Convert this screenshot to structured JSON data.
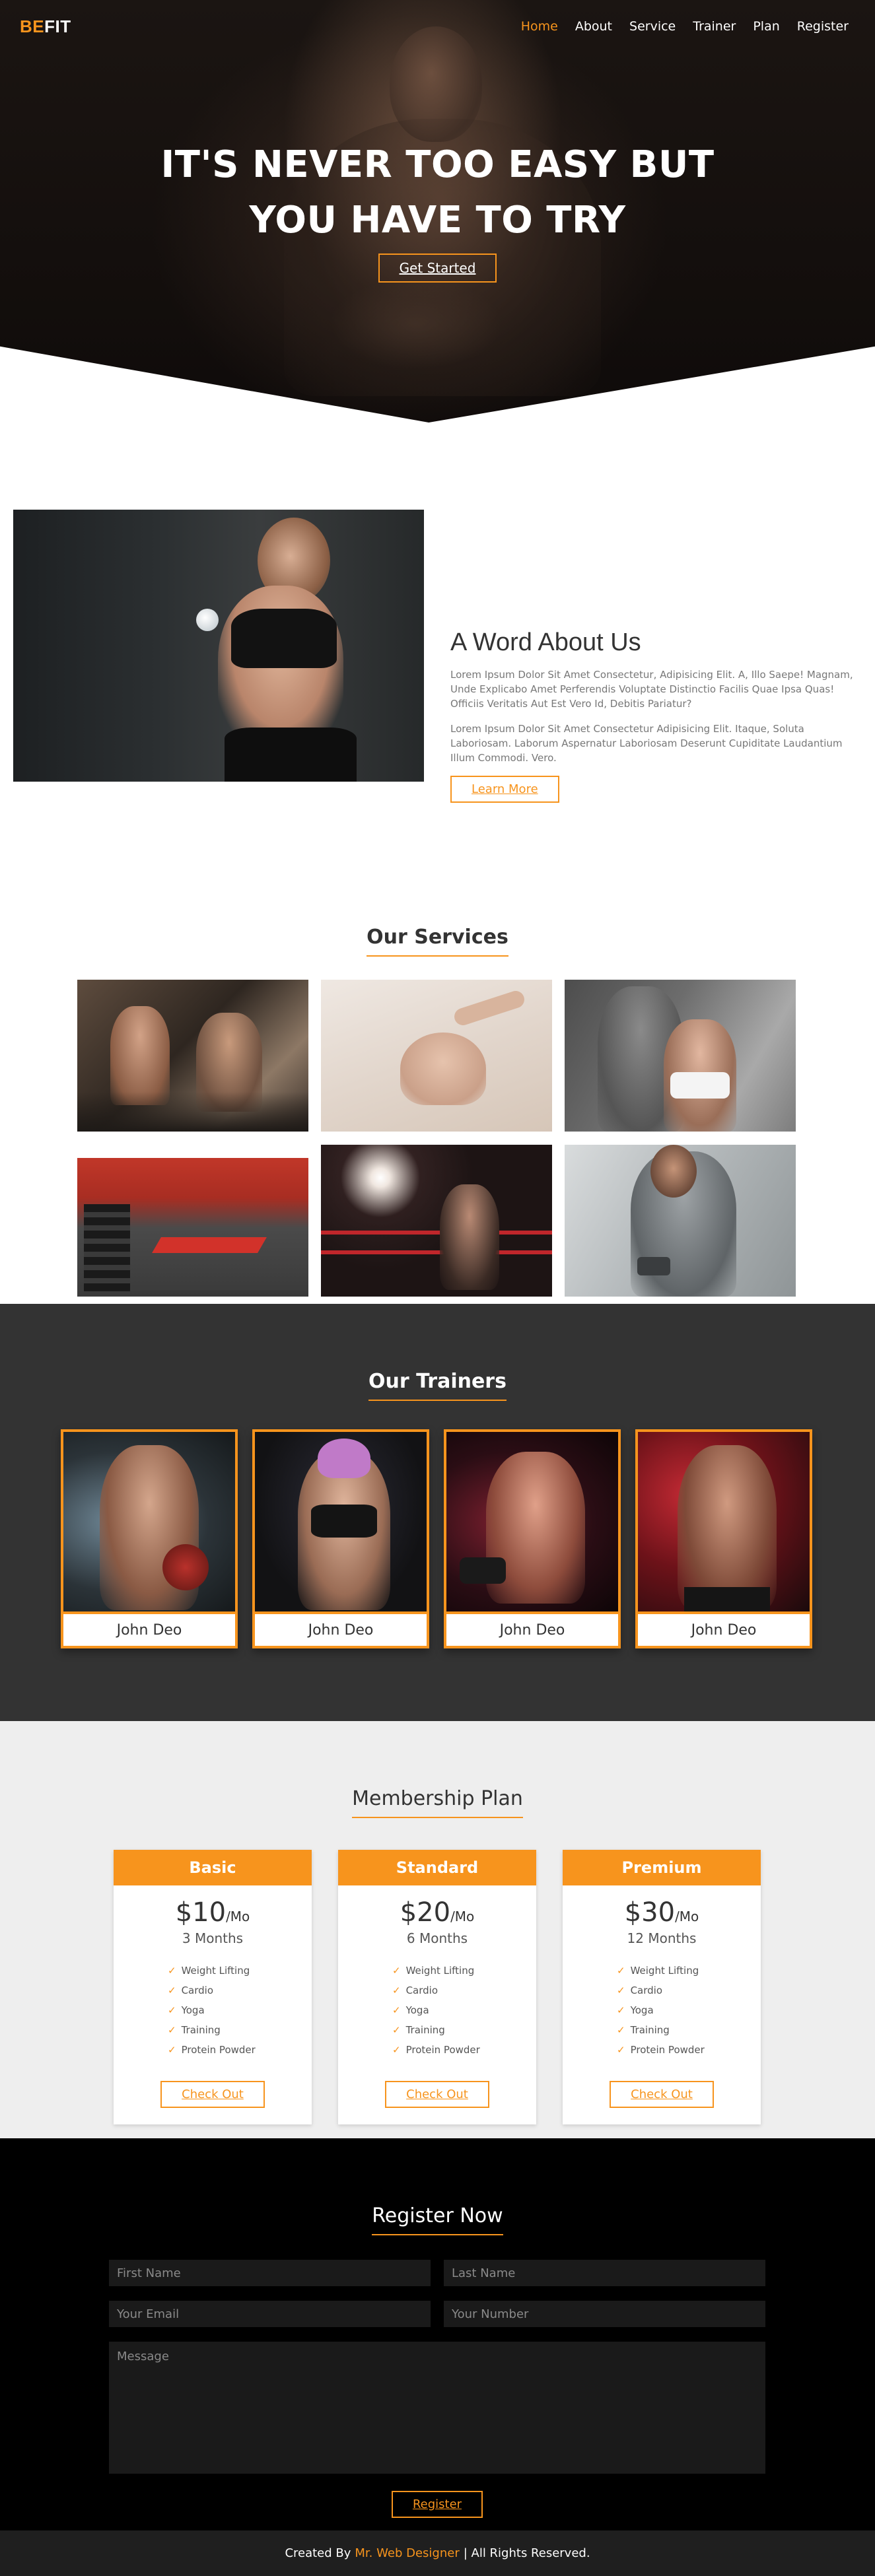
{
  "nav": {
    "logo_be": "BE",
    "logo_fit": "FIT",
    "links": [
      "Home",
      "About",
      "Service",
      "Trainer",
      "Plan",
      "Register"
    ]
  },
  "hero": {
    "title_line1": "IT'S NEVER TOO EASY BUT",
    "title_line2": "YOU HAVE TO TRY",
    "cta": "Get Started"
  },
  "about": {
    "title": "A Word About Us",
    "para1": "Lorem Ipsum Dolor Sit Amet Consectetur, Adipisicing Elit. A, Illo Saepe! Magnam, Unde Explicabo Amet Perferendis Voluptate Distinctio Facilis Quae Ipsa Quas! Officiis Veritatis Aut Est Vero Id, Debitis Pariatur?",
    "para2": "Lorem Ipsum Dolor Sit Amet Consectetur Adipisicing Elit. Itaque, Soluta Laboriosam. Laborum Aspernatur Laboriosam Deserunt Cupiditate Laudantium Illum Commodi. Vero.",
    "button": "Learn More"
  },
  "services": {
    "title": "Our Services"
  },
  "trainers": {
    "title": "Our Trainers",
    "names": [
      "John Deo",
      "John Deo",
      "John Deo",
      "John Deo"
    ]
  },
  "plans": {
    "title": "Membership Plan",
    "items": [
      {
        "name": "Basic",
        "price": "$10",
        "per": "/Mo",
        "duration": "3 Months",
        "features": [
          "Weight Lifting",
          "Cardio",
          "Yoga",
          "Training",
          "Protein Powder"
        ],
        "button": "Check Out"
      },
      {
        "name": "Standard",
        "price": "$20",
        "per": "/Mo",
        "duration": "6 Months",
        "features": [
          "Weight Lifting",
          "Cardio",
          "Yoga",
          "Training",
          "Protein Powder"
        ],
        "button": "Check Out"
      },
      {
        "name": "Premium",
        "price": "$30",
        "per": "/Mo",
        "duration": "12 Months",
        "features": [
          "Weight Lifting",
          "Cardio",
          "Yoga",
          "Training",
          "Protein Powder"
        ],
        "button": "Check Out"
      }
    ]
  },
  "register": {
    "title": "Register Now",
    "first_name": "First Name",
    "last_name": "Last Name",
    "email": "Your Email",
    "number": "Your Number",
    "message": "Message",
    "button": "Register"
  },
  "footer": {
    "prefix": "Created By",
    "designer": "Mr. Web Designer",
    "suffix": "| All Rights Reserved."
  },
  "colors": {
    "accent": "#f7941d",
    "dark": "#333333",
    "black": "#000000",
    "light": "#eeeeee"
  }
}
